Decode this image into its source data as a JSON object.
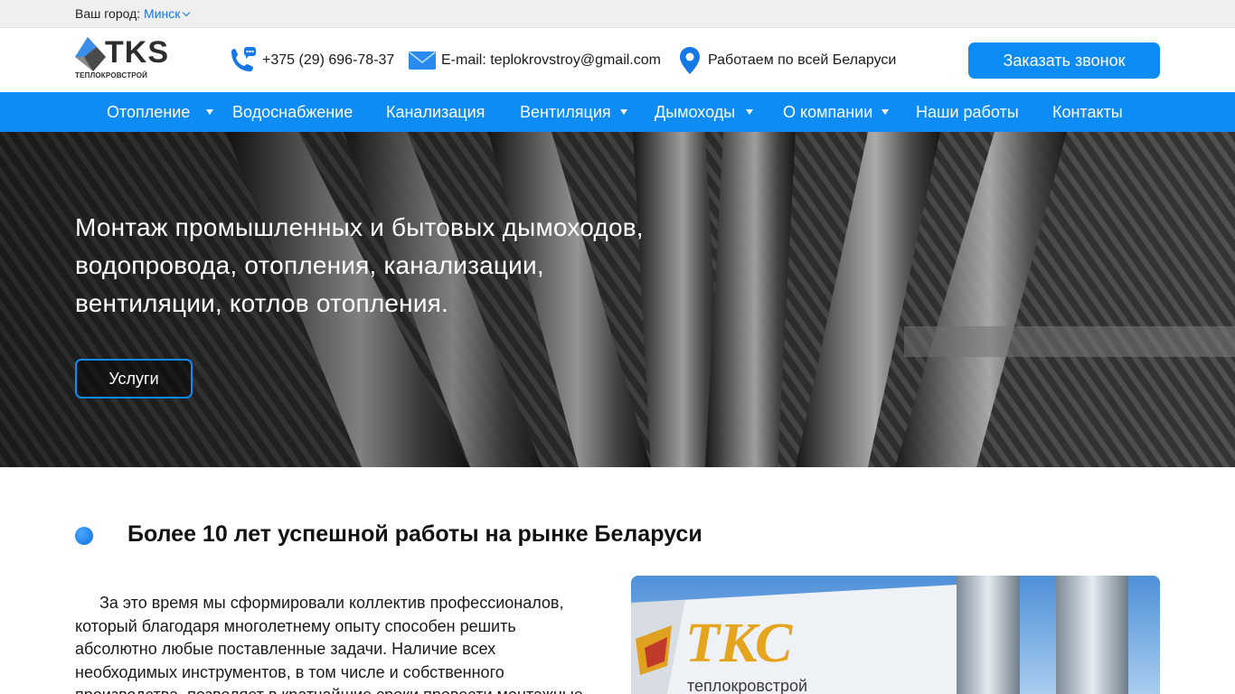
{
  "topbar": {
    "city_label": "Ваш город:",
    "city_value": "Минск"
  },
  "header": {
    "logo_text": "TKS",
    "logo_subtext": "ТЕПЛОКРОВСТРОЙ",
    "phone": "+375 (29) 696-78-37",
    "email": "E-mail: teplokrovstroy@gmail.com",
    "region": "Работаем по всей Беларуси",
    "call_button": "Заказать звонок"
  },
  "nav": {
    "items": [
      {
        "label": "Отопление",
        "has_dropdown": true
      },
      {
        "label": "Водоснабжение",
        "has_dropdown": false
      },
      {
        "label": "Канализация",
        "has_dropdown": false
      },
      {
        "label": "Вентиляция",
        "has_dropdown": true
      },
      {
        "label": "Дымоходы",
        "has_dropdown": true
      },
      {
        "label": "О компании",
        "has_dropdown": true
      },
      {
        "label": "Наши работы",
        "has_dropdown": false
      },
      {
        "label": "Контакты",
        "has_dropdown": false
      }
    ]
  },
  "hero": {
    "title_line1": "Монтаж промышленных и бытовых дымоходов,",
    "title_line2": "водопровода, отопления, канализации,",
    "title_line3": "вентиляции, котлов отопления.",
    "services_button": "Услуги"
  },
  "about": {
    "title": "Более 10 лет успешной работы на рынке Беларуси",
    "text": "За это время мы сформировали коллектив профессионалов, который благодаря многолетнему опыту способен решить абсолютно любые поставленные задачи. Наличие всех необходимых инструментов, в том числе и собственного производства, позволяет в кратчайшие сроки провести монтажные",
    "photo_flag_text": "ТКС",
    "photo_flag_subtext": "теплокровстрой"
  },
  "colors": {
    "accent": "#0d8cf5",
    "link": "#1677e6",
    "topbar_bg": "#efefef"
  },
  "icons": {
    "phone": "phone-icon",
    "email": "envelope-icon",
    "region": "map-pin-icon",
    "city_dropdown": "chevron-down-icon",
    "nav_dropdown": "caret-down-icon"
  }
}
